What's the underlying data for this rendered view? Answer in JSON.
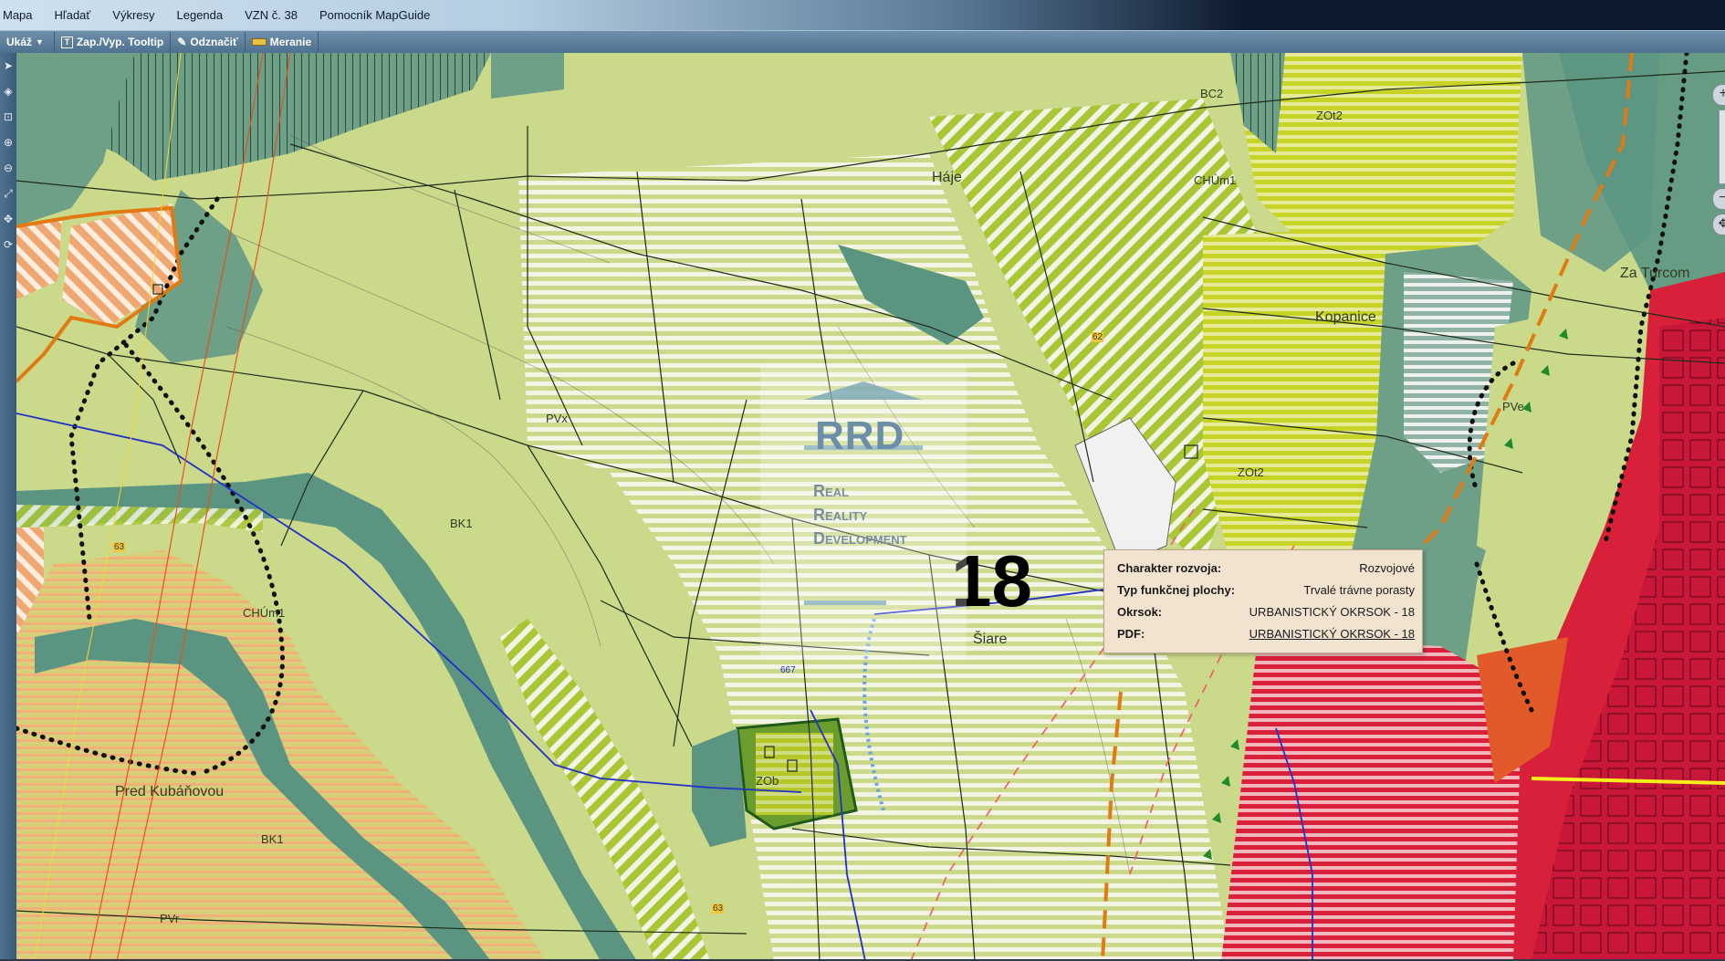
{
  "menu": {
    "items": [
      "Mapa",
      "Hľadať",
      "Výkresy",
      "Legenda",
      "VZN č. 38",
      "Pomocník MapGuide"
    ]
  },
  "toolbar": {
    "show_label": "Ukáž",
    "tooltip_label": "Zap./Vyp. Tooltip",
    "mark_label": "Odznačiť",
    "measure_label": "Meranie"
  },
  "map": {
    "labels": {
      "pvx": "PVx",
      "bk1_top": "BK1",
      "chum1_left": "CHÚm1",
      "pred_kubanovou": "Pred Kubáňovou",
      "bk1_bottom": "BK1",
      "pvr": "PVr",
      "haje": "Háje",
      "bc2": "BC2",
      "zot2_top": "ZOt2",
      "chum1_right": "CHÚm1",
      "za_turcom": "Za Turcom",
      "kopanice": "Kopanice",
      "pve": "PVe",
      "zot2_mid": "ZOt2",
      "siare": "Šiare",
      "zob": "ZOb",
      "num_63_a": "63",
      "num_63_b": "63",
      "num_62": "62",
      "num_667": "667"
    },
    "okrsok_number": "18",
    "colors": {
      "meadow": "#cbd98a",
      "forest": "#6e9f87",
      "water_corridor": "#5b9582",
      "urban_red": "#d8203a",
      "orange_agri": "#f3bb7c",
      "yellow_green": "#b5cf2c"
    }
  },
  "logo": {
    "title": "RRD",
    "line1": "Real",
    "line2": "Reality",
    "line3": "Development"
  },
  "popup": {
    "rows": [
      {
        "key": "Charakter rozvoja:",
        "value": "Rozvojové"
      },
      {
        "key": "Typ funkčnej plochy:",
        "value": "Trvalé trávne porasty"
      },
      {
        "key": "Okrsok:",
        "value": "URBANISTICKÝ OKRSOK - 18"
      },
      {
        "key": "PDF:",
        "value": "URBANISTICKÝ OKRSOK - 18"
      }
    ]
  }
}
